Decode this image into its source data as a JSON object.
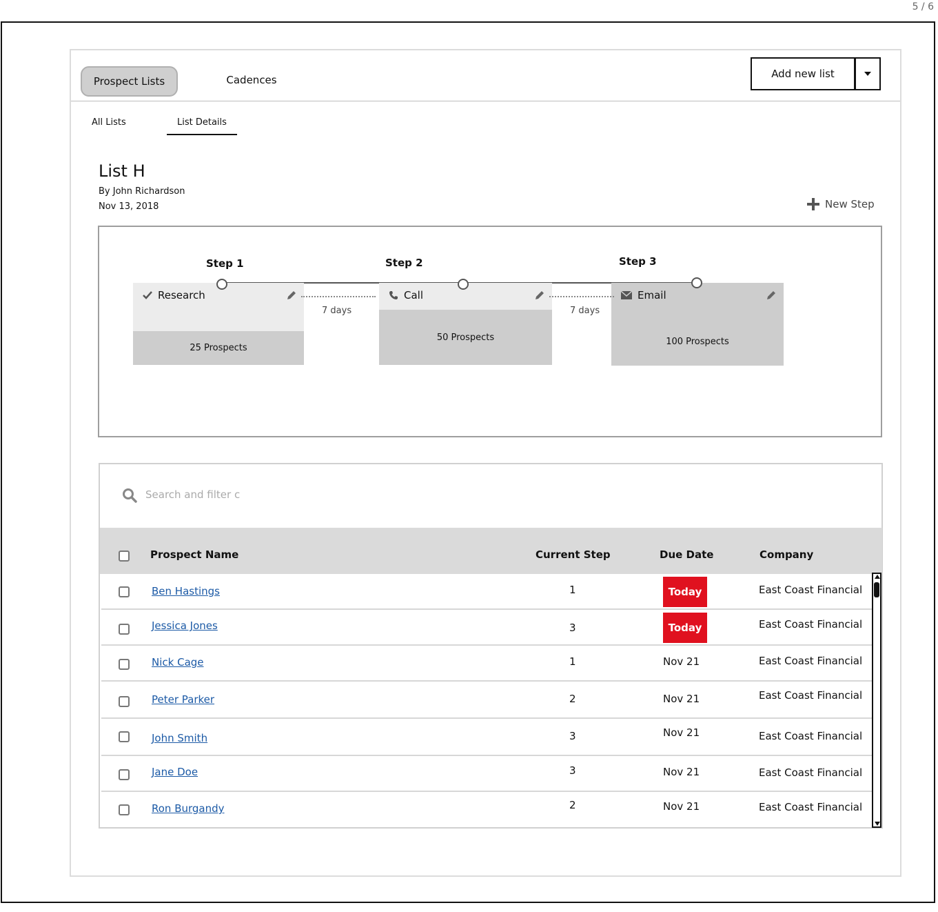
{
  "page_counter": "5 / 6",
  "nav": {
    "tabs": [
      {
        "label": "Prospect Lists",
        "active": true
      },
      {
        "label": "Cadences",
        "active": false
      }
    ],
    "add_button_label": "Add new list"
  },
  "subtabs": [
    {
      "label": "All Lists",
      "active": false
    },
    {
      "label": "List Details",
      "active": true
    }
  ],
  "list": {
    "title": "List H",
    "author": "By John Richardson",
    "date": "Nov 13, 2018",
    "new_step_label": "New Step"
  },
  "steps": [
    {
      "title": "Step 1",
      "type": "Research",
      "icon": "check-icon",
      "prospects": "25 Prospects"
    },
    {
      "title": "Step 2",
      "type": "Call",
      "icon": "phone-icon",
      "prospects": "50 Prospects"
    },
    {
      "title": "Step 3",
      "type": "Email",
      "icon": "envelope-icon",
      "prospects": "100 Prospects"
    }
  ],
  "gaps": [
    "7 days",
    "7 days"
  ],
  "search": {
    "placeholder": "Search and filter c"
  },
  "table": {
    "columns": [
      "Prospect Name",
      "Current Step",
      "Due Date",
      "Company"
    ],
    "rows": [
      {
        "name": "Ben Hastings",
        "step": "1",
        "due": "Today",
        "company": "East Coast Financial"
      },
      {
        "name": "Jessica Jones",
        "step": "3",
        "due": "Today",
        "company": "East Coast Financial"
      },
      {
        "name": "Nick Cage",
        "step": "1",
        "due": "Nov 21",
        "company": "East Coast Financial"
      },
      {
        "name": "Peter Parker",
        "step": "2",
        "due": "Nov 21",
        "company": "East Coast Financial"
      },
      {
        "name": "John Smith",
        "step": "3",
        "due": "Nov 21",
        "company": "East Coast Financial"
      },
      {
        "name": "Jane Doe",
        "step": "3",
        "due": "Nov 21",
        "company": "East Coast Financial"
      },
      {
        "name": "Ron Burgandy",
        "step": "2",
        "due": "Nov 21",
        "company": "East Coast Financial"
      }
    ]
  },
  "colors": {
    "today_badge": "#e0111f",
    "link": "#1c5aa6",
    "header_bg": "#dadada"
  }
}
